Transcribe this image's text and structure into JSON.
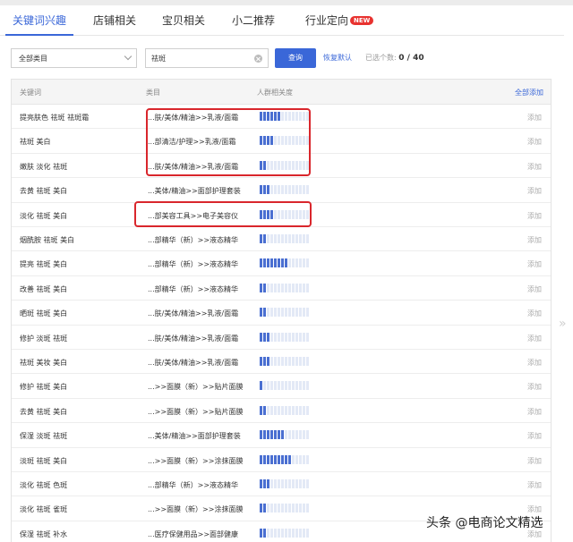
{
  "tabs": [
    {
      "label": "关键词兴趣",
      "active": true
    },
    {
      "label": "店铺相关"
    },
    {
      "label": "宝贝相关"
    },
    {
      "label": "小二推荐"
    },
    {
      "label": "行业定向",
      "badge": "NEW"
    }
  ],
  "filter": {
    "category_value": "全部类目",
    "search_value": "祛斑",
    "query_label": "查询",
    "reset_label": "恢复默认",
    "selected_label": "已选个数:",
    "selected_count": "0 / 40"
  },
  "table": {
    "headers": {
      "keyword": "关键词",
      "category": "类目",
      "relevance": "人群相关度",
      "add_all": "全部添加"
    },
    "add_label": "添加",
    "rows": [
      {
        "keyword": "提亮肤色 祛斑 祛斑霜",
        "category": "...肤/美体/精油>>乳液/面霜",
        "relevance": 6
      },
      {
        "keyword": "祛斑 美白",
        "category": "...部清洁/护理>>乳液/面霜",
        "relevance": 4
      },
      {
        "keyword": "嫩肤 淡化 祛斑",
        "category": "...肤/美体/精油>>乳液/面霜",
        "relevance": 2
      },
      {
        "keyword": "去黄 祛斑 美白",
        "category": "...美体/精油>>面部护理套装",
        "relevance": 3
      },
      {
        "keyword": "淡化 祛斑 美白",
        "category": "...部美容工具>>电子美容仪",
        "relevance": 4
      },
      {
        "keyword": "烟酰胺 祛斑 美白",
        "category": "...部精华（新）>>液态精华",
        "relevance": 2
      },
      {
        "keyword": "提亮 祛斑 美白",
        "category": "...部精华（新）>>液态精华",
        "relevance": 8
      },
      {
        "keyword": "改善 祛斑 美白",
        "category": "...部精华（新）>>液态精华",
        "relevance": 2
      },
      {
        "keyword": "晒斑 祛斑 美白",
        "category": "...肤/美体/精油>>乳液/面霜",
        "relevance": 2
      },
      {
        "keyword": "修护 淡斑 祛斑",
        "category": "...肤/美体/精油>>乳液/面霜",
        "relevance": 3
      },
      {
        "keyword": "祛斑 美妆 美白",
        "category": "...肤/美体/精油>>乳液/面霜",
        "relevance": 3
      },
      {
        "keyword": "修护 祛斑 美白",
        "category": "...>>面膜（新）>>贴片面膜",
        "relevance": 1
      },
      {
        "keyword": "去黄 祛斑 美白",
        "category": "...>>面膜（新）>>贴片面膜",
        "relevance": 2
      },
      {
        "keyword": "保湿 淡斑 祛斑",
        "category": "...美体/精油>>面部护理套装",
        "relevance": 7
      },
      {
        "keyword": "淡斑 祛斑 美白",
        "category": "...>>面膜（新）>>涂抹面膜",
        "relevance": 9
      },
      {
        "keyword": "淡化 祛斑 色斑",
        "category": "...部精华（新）>>液态精华",
        "relevance": 3
      },
      {
        "keyword": "淡化 祛斑 雀斑",
        "category": "...>>面膜（新）>>涂抹面膜",
        "relevance": 2
      },
      {
        "keyword": "保湿 祛斑 补水",
        "category": "...医疗保健用品>>面部健康",
        "relevance": 2
      }
    ]
  },
  "watermark": "头条 @电商论文精选",
  "colors": {
    "accent": "#3a67d8",
    "highlight": "#d9262c",
    "badge": "#e8322f"
  }
}
